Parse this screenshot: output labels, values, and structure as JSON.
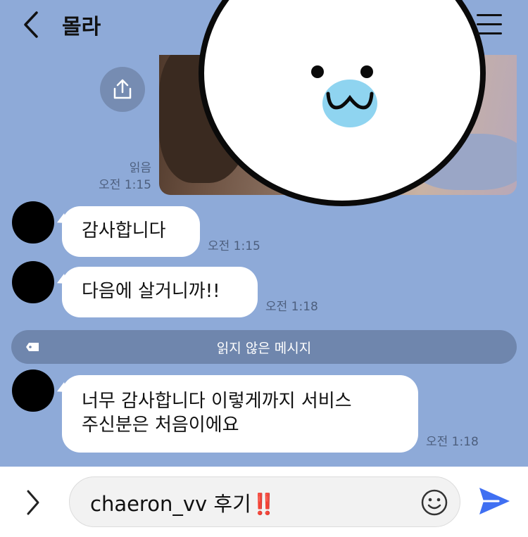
{
  "header": {
    "title": "몰라",
    "back_icon": "chevron-left-icon",
    "menu_icon": "hamburger-menu-icon"
  },
  "photo_message": {
    "share_icon": "share-upload-icon",
    "read_label": "읽음",
    "time": "오전 1:15"
  },
  "messages": [
    {
      "text": "감사합니다",
      "time": "오전 1:15"
    },
    {
      "text": "다음에 살거니까!!",
      "time": "오전 1:18"
    },
    {
      "lines": [
        "너무 감사합니다 이렇게까지 서비스",
        "주신분은 처음이에요"
      ],
      "time": "오전 1:18"
    }
  ],
  "unread_divider": {
    "label": "읽지 않은 메시지",
    "icon": "tag-icon"
  },
  "composer": {
    "value": "chaeron_vv 후기",
    "value_emoji": "‼️",
    "plus_icon": "chevron-right-icon",
    "emoji_icon": "smiley-icon",
    "send_icon": "send-icon"
  },
  "colors": {
    "chat_background": "#8eaad8",
    "send_accent": "#3f6ff2",
    "divider": "#6f86ad"
  }
}
